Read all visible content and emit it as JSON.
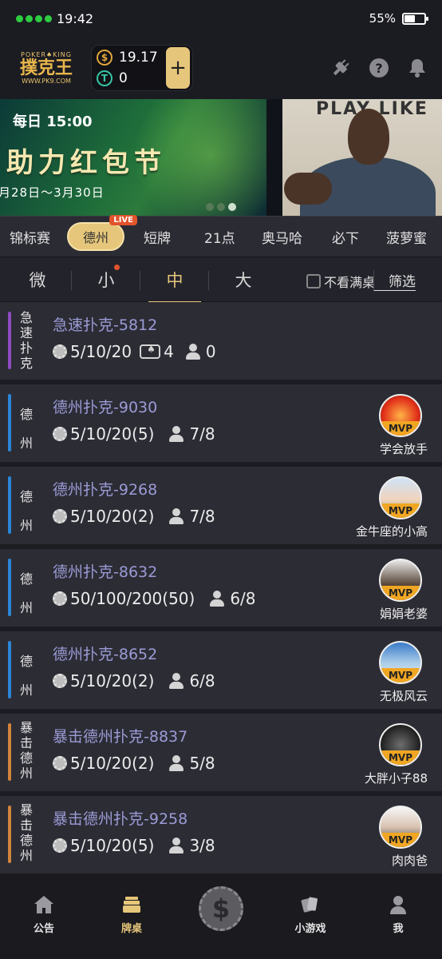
{
  "status_bar": {
    "time": "19:42",
    "battery": "55%",
    "battery_level": 0.55
  },
  "header": {
    "logo": {
      "top": "POKER♠KING",
      "main": "撲克王",
      "url": "WWW.PK9.COM"
    },
    "wallet": {
      "gold_balance": "19.17",
      "gold_symbol": "$",
      "token_balance": "0",
      "token_symbol": "T",
      "add_label": "+"
    },
    "icons": [
      "plug-icon",
      "help-icon",
      "bell-icon"
    ]
  },
  "banner": {
    "time": "每日 15:00",
    "title": "助力红包节",
    "date": "月28日～3月30日",
    "right_text": "PLAY LIKE"
  },
  "categories": {
    "items": [
      "锦标赛",
      "德州",
      "短牌",
      "21点",
      "奥马哈",
      "必下",
      "菠萝蜜"
    ],
    "active": "德州",
    "live_badge": "LIVE"
  },
  "stakes": {
    "items": [
      "微",
      "小",
      "中",
      "大"
    ],
    "active": "中",
    "hide_full": "不看满桌",
    "filter": "筛选"
  },
  "tables": [
    {
      "type_label": "急速扑克",
      "title": "急速扑克-5812",
      "blinds": "5/10/20",
      "tables_count": "4",
      "players": "0",
      "accent": "#8e4ac0",
      "mvp": null
    },
    {
      "type_label": "德州",
      "title": "德州扑克-9030",
      "blinds": "5/10/20(5)",
      "players": "7/8",
      "accent": "#2a86d6",
      "mvp": {
        "badge": "MVP",
        "name": "学会放手"
      }
    },
    {
      "type_label": "德州",
      "title": "德州扑克-9268",
      "blinds": "5/10/20(2)",
      "players": "7/8",
      "accent": "#2a86d6",
      "mvp": {
        "badge": "MVP",
        "name": "金牛座的小高"
      }
    },
    {
      "type_label": "德州",
      "title": "德州扑克-8632",
      "blinds": "50/100/200(50)",
      "players": "6/8",
      "accent": "#2a86d6",
      "mvp": {
        "badge": "MVP",
        "name": "娟娟老婆"
      }
    },
    {
      "type_label": "德州",
      "title": "德州扑克-8652",
      "blinds": "5/10/20(2)",
      "players": "6/8",
      "accent": "#2a86d6",
      "mvp": {
        "badge": "MVP",
        "name": "无极风云"
      }
    },
    {
      "type_label": "暴击德州",
      "title": "暴击德州扑克-8837",
      "blinds": "5/10/20(2)",
      "players": "5/8",
      "accent": "#d0843a",
      "mvp": {
        "badge": "MVP",
        "name": "大胖小子88"
      }
    },
    {
      "type_label": "暴击德州",
      "title": "暴击德州扑克-9258",
      "blinds": "5/10/20(5)",
      "players": "3/8",
      "accent": "#d0843a",
      "mvp": {
        "badge": "MVP",
        "name": "肉肉爸"
      }
    }
  ],
  "bottom_nav": {
    "items": [
      "公告",
      "牌桌",
      "小游戏",
      "我"
    ],
    "center_icon": "$",
    "active": "牌桌"
  },
  "colors": {
    "accent_gold": "#e6c67a",
    "live_red": "#e2542b",
    "title_purple": "#9b9bd6"
  }
}
